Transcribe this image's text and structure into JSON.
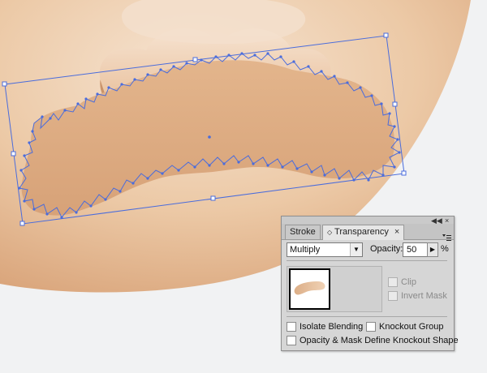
{
  "panel": {
    "tabs": [
      {
        "label": "Stroke",
        "active": false
      },
      {
        "label": "Transparency",
        "active": true,
        "prefix_icon": "updown-arrows-icon",
        "close": "×"
      }
    ],
    "window_controls": {
      "collapse": "◀◀",
      "close": "×"
    },
    "menu_icon": "panel-menu-icon",
    "blend_mode": "Multiply",
    "opacity_label": "Opacity:",
    "opacity_value": "50",
    "opacity_unit": "%",
    "clip_label": "Clip",
    "invert_mask_label": "Invert Mask",
    "isolate_blending_label": "Isolate Blending",
    "knockout_group_label": "Knockout Group",
    "opacity_mask_knockout_label": "Opacity & Mask Define Knockout Shape"
  },
  "colors": {
    "skin_light": "#f3dcc6",
    "skin_mid": "#dcaa80",
    "path_blue": "#4a6cdc"
  }
}
